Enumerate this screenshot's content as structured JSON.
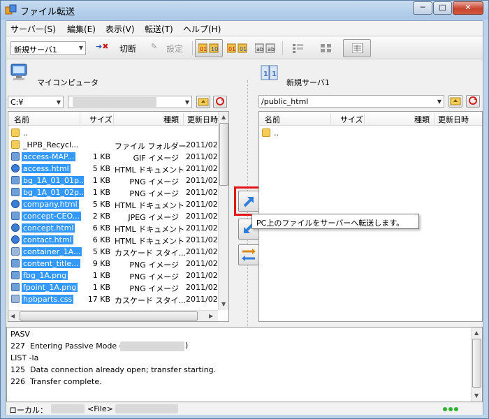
{
  "window": {
    "title": "ファイル転送",
    "minimize": "─",
    "maximize": "□",
    "close": "✕"
  },
  "menu": [
    "サーバー(S)",
    "編集(E)",
    "表示(V)",
    "転送(T)",
    "ヘルプ(H)"
  ],
  "toolbar": {
    "server_select": "新規サーバ1",
    "disconnect_label": "切断",
    "settings_label": "設定"
  },
  "local": {
    "title": "マイコンピュータ",
    "drive": "C:¥",
    "columns": {
      "name": "名前",
      "size": "サイズ",
      "type": "種類",
      "date": "更新日時"
    },
    "files": [
      {
        "name": "..",
        "size": "",
        "type": "",
        "date": "",
        "icon": "up-folder-icon",
        "selected": false
      },
      {
        "name": "_HPB_Recycl...",
        "size": "",
        "type": "ファイル フォルダー",
        "date": "2011/02",
        "icon": "folder-icon",
        "selected": false
      },
      {
        "name": "access-MAP...",
        "size": "1 KB",
        "type": "GIF イメージ",
        "date": "2011/02",
        "icon": "image-file-icon",
        "selected": true
      },
      {
        "name": "access.html",
        "size": "5 KB",
        "type": "HTML ドキュメント",
        "date": "2011/02",
        "icon": "html-file-icon",
        "selected": true
      },
      {
        "name": "bg_1A_01_01p...",
        "size": "1 KB",
        "type": "PNG イメージ",
        "date": "2011/02",
        "icon": "image-file-icon",
        "selected": true
      },
      {
        "name": "bg_1A_01_02p...",
        "size": "1 KB",
        "type": "PNG イメージ",
        "date": "2011/02",
        "icon": "image-file-icon",
        "selected": true
      },
      {
        "name": "company.html",
        "size": "5 KB",
        "type": "HTML ドキュメント",
        "date": "2011/02",
        "icon": "html-file-icon",
        "selected": true
      },
      {
        "name": "concept-CEO...",
        "size": "2 KB",
        "type": "JPEG イメージ",
        "date": "2011/02",
        "icon": "image-file-icon",
        "selected": true
      },
      {
        "name": "concept.html",
        "size": "6 KB",
        "type": "HTML ドキュメント",
        "date": "2011/02",
        "icon": "html-file-icon",
        "selected": true
      },
      {
        "name": "contact.html",
        "size": "6 KB",
        "type": "HTML ドキュメント",
        "date": "2011/02",
        "icon": "html-file-icon",
        "selected": true
      },
      {
        "name": "container_1A...",
        "size": "5 KB",
        "type": "カスケード スタイ...",
        "date": "2011/02",
        "icon": "css-file-icon",
        "selected": true
      },
      {
        "name": "content_title...",
        "size": "9 KB",
        "type": "PNG イメージ",
        "date": "2011/02",
        "icon": "image-file-icon",
        "selected": true
      },
      {
        "name": "fbg_1A.png",
        "size": "1 KB",
        "type": "PNG イメージ",
        "date": "2011/02",
        "icon": "image-file-icon",
        "selected": true
      },
      {
        "name": "fpoint_1A.png",
        "size": "1 KB",
        "type": "PNG イメージ",
        "date": "2011/02",
        "icon": "image-file-icon",
        "selected": true
      },
      {
        "name": "hpbparts.css",
        "size": "17 KB",
        "type": "カスケード スタイ...",
        "date": "2011/02",
        "icon": "css-file-icon",
        "selected": true
      }
    ]
  },
  "remote": {
    "title": "新規サーバ1",
    "path": "/public_html",
    "columns": {
      "name": "名前",
      "size": "サイズ",
      "type": "種類",
      "date": "更新日時"
    },
    "files": [
      {
        "name": "..",
        "icon": "up-folder-icon"
      }
    ]
  },
  "tooltip": "PC上のファイルをサーバーへ転送します。",
  "log": [
    "PASV",
    "227  Entering Passive Mode (",
    "LIST -la",
    "125  Data connection already open; transfer starting.",
    "226  Transfer complete."
  ],
  "status": {
    "local_label": "ローカル：",
    "file_label": "<File>"
  },
  "colors": {
    "selection": "#3399ff",
    "highlight_box": "#e6141c",
    "accent": "#2f7fd8"
  }
}
